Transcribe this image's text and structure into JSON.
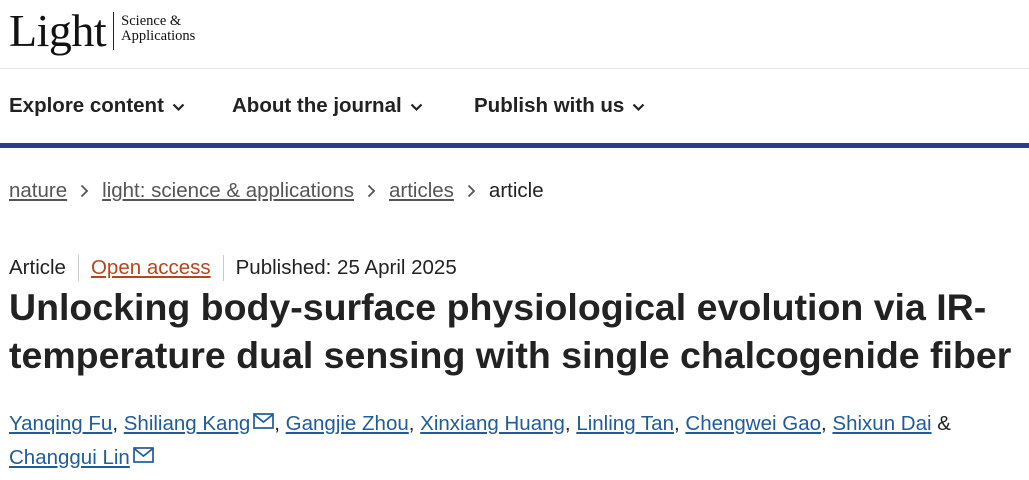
{
  "logo": {
    "word": "Light",
    "sub_line1": "Science &",
    "sub_line2": "Applications"
  },
  "nav": {
    "items": [
      {
        "label": "Explore content"
      },
      {
        "label": "About the journal"
      },
      {
        "label": "Publish with us"
      }
    ]
  },
  "breadcrumb": {
    "items": [
      {
        "label": "nature"
      },
      {
        "label": "light: science & applications"
      },
      {
        "label": "articles"
      }
    ],
    "current": "article"
  },
  "meta": {
    "type": "Article",
    "access": "Open access",
    "published": "Published: 25 April 2025"
  },
  "article": {
    "title": "Unlocking body-surface physiological evolution via IR-temperature dual sensing with single chalcogenide fiber"
  },
  "authors": {
    "list": [
      {
        "name": "Yanqing Fu"
      },
      {
        "name": "Shiliang Kang"
      },
      {
        "name": "Gangjie Zhou"
      },
      {
        "name": "Xinxiang Huang"
      },
      {
        "name": "Linling Tan"
      },
      {
        "name": "Chengwei Gao"
      },
      {
        "name": "Shixun Dai"
      },
      {
        "name": "Changgui Lin"
      }
    ],
    "comma": ",",
    "ampersand": "&"
  },
  "icons": {
    "chevron": "chevron-down-icon",
    "breadcrumb_sep": "chevron-right-icon",
    "mail": "mail-icon"
  },
  "colors": {
    "accent_rule": "#2c3c8c",
    "open_access": "#b7451b",
    "author_link": "#1f5c99"
  }
}
